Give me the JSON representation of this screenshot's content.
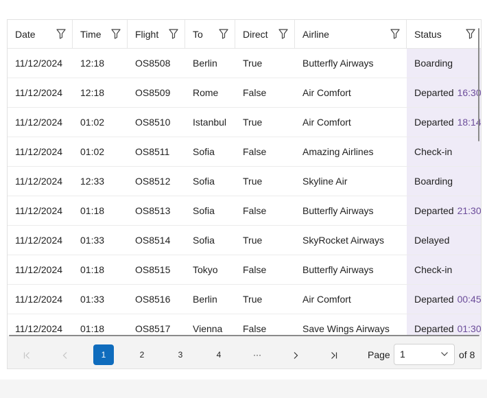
{
  "columns": [
    {
      "label": "Date"
    },
    {
      "label": "Time"
    },
    {
      "label": "Flight"
    },
    {
      "label": "To"
    },
    {
      "label": "Direct"
    },
    {
      "label": "Airline"
    },
    {
      "label": "Status"
    }
  ],
  "rows": [
    {
      "date": "11/12/2024",
      "time": "12:18",
      "flight": "OS8508",
      "to": "Berlin",
      "direct": "True",
      "airline": "Butterfly Airways",
      "status": "Boarding",
      "status_time": ""
    },
    {
      "date": "11/12/2024",
      "time": "12:18",
      "flight": "OS8509",
      "to": "Rome",
      "direct": "False",
      "airline": "Air Comfort",
      "status": "Departed",
      "status_time": "16:30"
    },
    {
      "date": "11/12/2024",
      "time": "01:02",
      "flight": "OS8510",
      "to": "Istanbul",
      "direct": "True",
      "airline": "Air Comfort",
      "status": "Departed",
      "status_time": "18:14"
    },
    {
      "date": "11/12/2024",
      "time": "01:02",
      "flight": "OS8511",
      "to": "Sofia",
      "direct": "False",
      "airline": "Amazing Airlines",
      "status": "Check-in",
      "status_time": ""
    },
    {
      "date": "11/12/2024",
      "time": "12:33",
      "flight": "OS8512",
      "to": "Sofia",
      "direct": "True",
      "airline": "Skyline Air",
      "status": "Boarding",
      "status_time": ""
    },
    {
      "date": "11/12/2024",
      "time": "01:18",
      "flight": "OS8513",
      "to": "Sofia",
      "direct": "False",
      "airline": "Butterfly Airways",
      "status": "Departed",
      "status_time": "21:30"
    },
    {
      "date": "11/12/2024",
      "time": "01:33",
      "flight": "OS8514",
      "to": "Sofia",
      "direct": "True",
      "airline": "SkyRocket Airways",
      "status": "Delayed",
      "status_time": ""
    },
    {
      "date": "11/12/2024",
      "time": "01:18",
      "flight": "OS8515",
      "to": "Tokyo",
      "direct": "False",
      "airline": "Butterfly Airways",
      "status": "Check-in",
      "status_time": ""
    },
    {
      "date": "11/12/2024",
      "time": "01:33",
      "flight": "OS8516",
      "to": "Berlin",
      "direct": "True",
      "airline": "Air Comfort",
      "status": "Departed",
      "status_time": "00:45"
    },
    {
      "date": "11/12/2024",
      "time": "01:18",
      "flight": "OS8517",
      "to": "Vienna",
      "direct": "False",
      "airline": "Save Wings Airways",
      "status": "Departed",
      "status_time": "01:30"
    }
  ],
  "pager": {
    "pages": [
      "1",
      "2",
      "3",
      "4"
    ],
    "ellipsis": "···",
    "current_page": "1",
    "page_label": "Page",
    "select_value": "1",
    "of_label": "of 8"
  },
  "icons": {
    "filter": "filter-icon",
    "first": "first-page-icon",
    "prev": "previous-page-icon",
    "next": "next-page-icon",
    "last": "last-page-icon",
    "dropdown": "chevron-down-icon"
  },
  "colors": {
    "accent": "#0f6cbd",
    "status_highlight": "#efebf7",
    "status_time_text": "#6b4c9a"
  }
}
